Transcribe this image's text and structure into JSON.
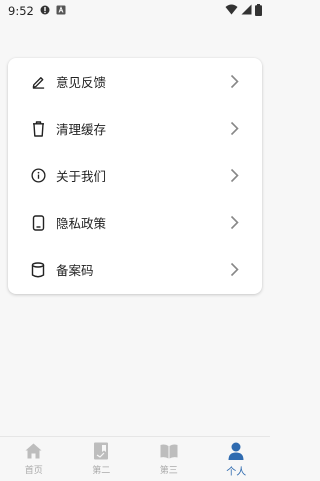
{
  "status_bar": {
    "time": "9:52"
  },
  "menu": {
    "items": [
      {
        "label": "意见反馈",
        "icon": "edit-icon"
      },
      {
        "label": "清理缓存",
        "icon": "trash-icon"
      },
      {
        "label": "关于我们",
        "icon": "info-icon"
      },
      {
        "label": "隐私政策",
        "icon": "phone-icon"
      },
      {
        "label": "备案码",
        "icon": "database-icon"
      }
    ]
  },
  "bottom_nav": {
    "items": [
      {
        "label": "首页",
        "icon": "home-icon"
      },
      {
        "label": "第二",
        "icon": "bookmark-icon"
      },
      {
        "label": "第三",
        "icon": "book-icon"
      },
      {
        "label": "个人",
        "icon": "user-icon"
      }
    ],
    "active_index": 3
  },
  "colors": {
    "accent": "#2f6bb0",
    "inactive": "#aaaaaa",
    "background": "#f7f7f7"
  }
}
